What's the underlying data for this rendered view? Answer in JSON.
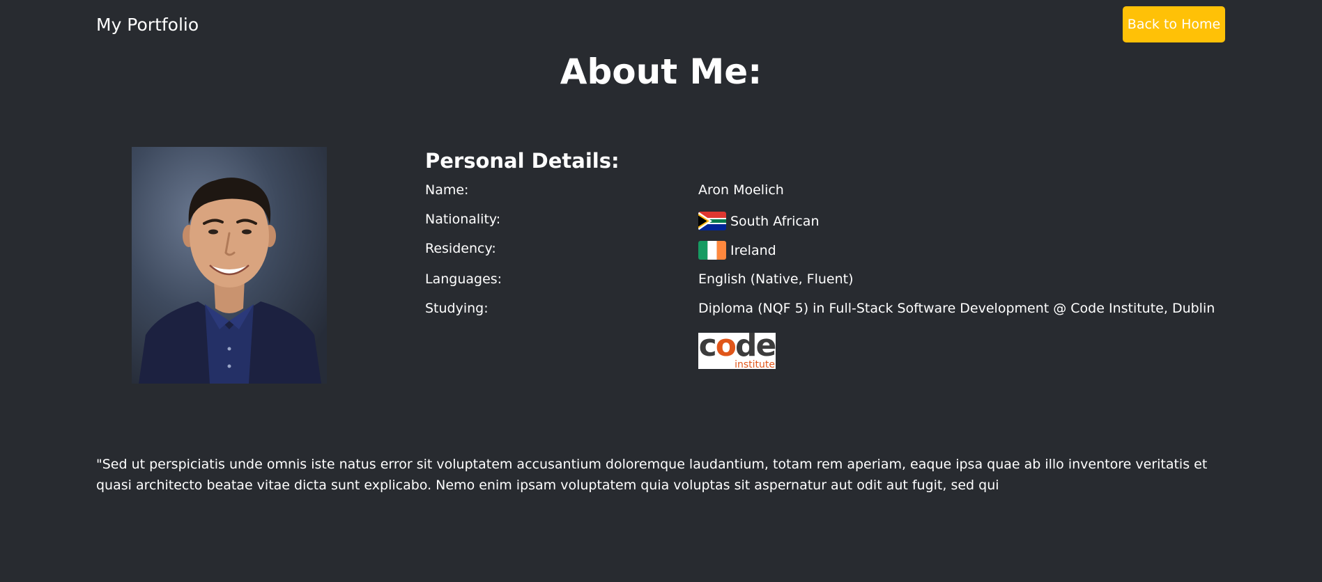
{
  "navbar": {
    "brand": "My Portfolio",
    "home_button": "Back to Home",
    "button_color": "#ffc107"
  },
  "page": {
    "title": "About Me:",
    "background_color": "#282b30"
  },
  "profile_photo": {
    "icon": "profile-photo"
  },
  "personal_details": {
    "title": "Personal Details:",
    "rows": [
      {
        "label": "Name:",
        "value": "Aron Moelich"
      },
      {
        "label": "Nationality:",
        "value": "South African",
        "flag": "south-africa-flag"
      },
      {
        "label": "Residency:",
        "value": "Ireland",
        "flag": "ireland-flag"
      },
      {
        "label": "Languages:",
        "value": "English (Native, Fluent)"
      },
      {
        "label": "Studying:",
        "value": "Diploma (NQF 5) in Full-Stack Software Development @ Code Institute, Dublin"
      }
    ],
    "logo": {
      "main_c": "c",
      "main_o": "o",
      "main_de": "de",
      "sub": "institute",
      "accent_color": "#e0561a"
    }
  },
  "about_text": "\"Sed ut perspiciatis unde omnis iste natus error sit voluptatem accusantium doloremque laudantium, totam rem aperiam, eaque ipsa quae ab illo inventore veritatis et quasi architecto beatae vitae dicta sunt explicabo. Nemo enim ipsam voluptatem quia voluptas sit aspernatur aut odit aut fugit, sed qui"
}
